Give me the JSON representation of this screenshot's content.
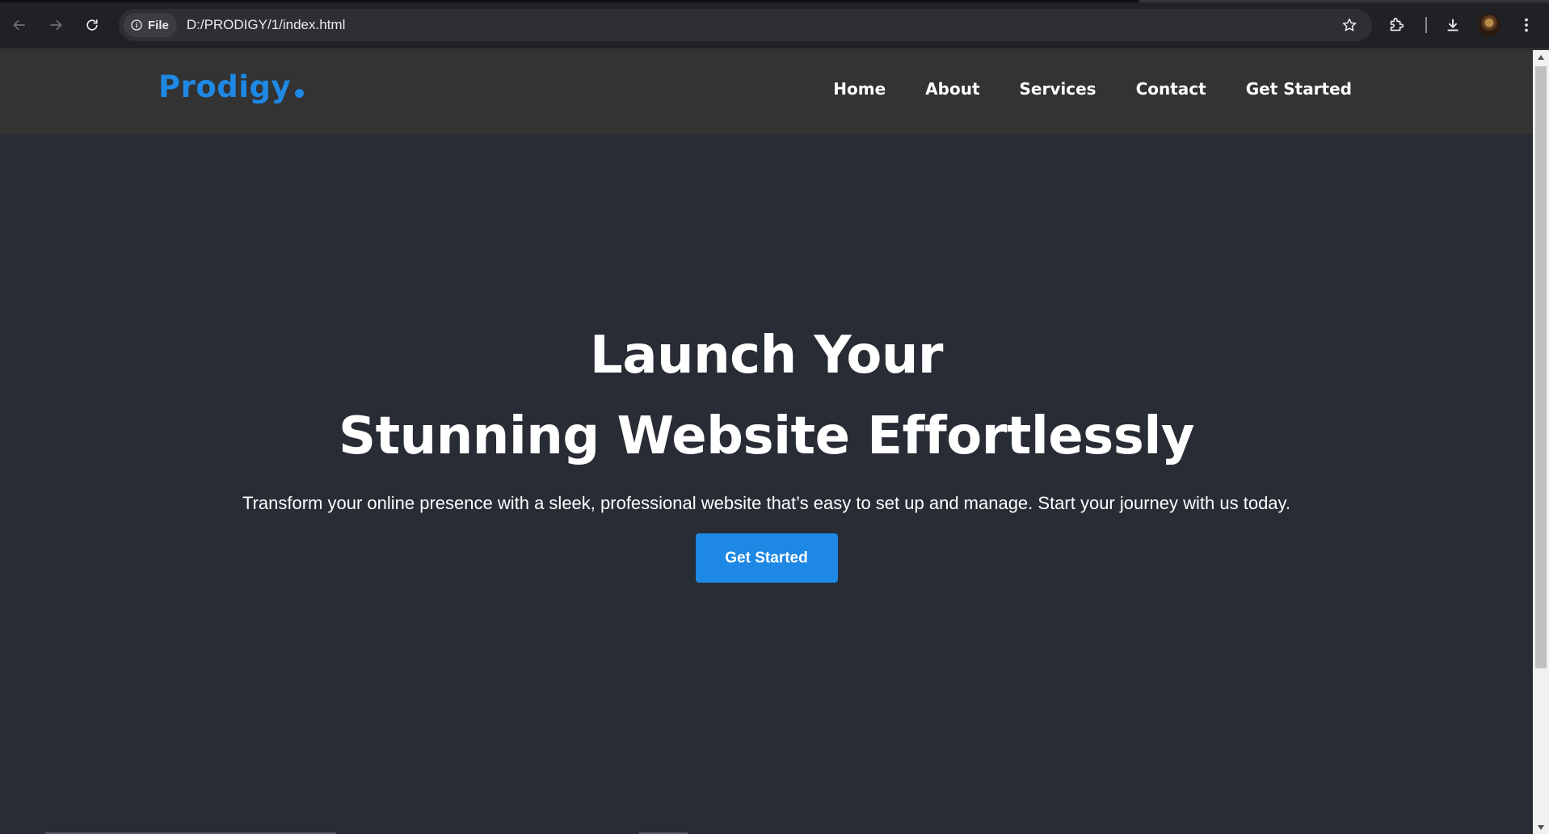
{
  "browser": {
    "site_chip_label": "File",
    "url": "D:/PRODIGY/1/index.html"
  },
  "site": {
    "logo": "Prodigy",
    "nav": [
      "Home",
      "About",
      "Services",
      "Contact",
      "Get Started"
    ],
    "hero": {
      "title_line1": "Launch Your",
      "title_line2": "Stunning Website Effortlessly",
      "subtitle": "Transform your online presence with a sleek, professional website that’s easy to set up and manage. Start your journey with us today.",
      "cta_label": "Get Started"
    }
  },
  "colors": {
    "accent": "#1e88e5",
    "header_bg": "#333333",
    "page_bg": "#282c35"
  }
}
